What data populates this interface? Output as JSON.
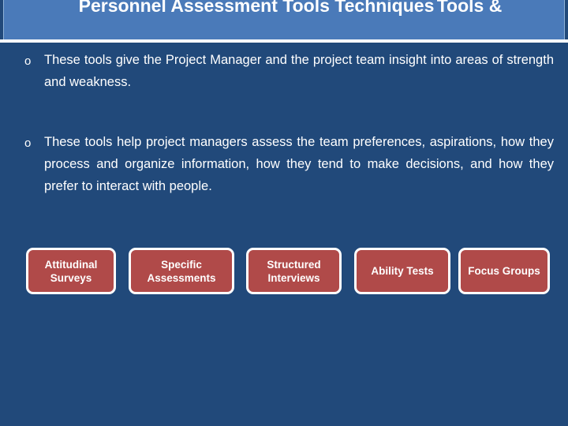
{
  "slide": {
    "background_color": "#21497a",
    "header": {
      "band_color": "#4a7ab9",
      "title_main": "Personnel Assessment Tools Techniques",
      "title_secondary": "Tools &"
    },
    "bullets": [
      {
        "marker": "circle-outline-bullet",
        "marker_glyph": "o",
        "text": "These tools give the Project Manager and the project team insight into areas of strength and weakness."
      },
      {
        "marker": "circle-outline-bullet",
        "marker_glyph": "o",
        "text": "These tools help project managers assess the team preferences, aspirations, how they process and organize information, how they tend to make decisions, and how they prefer to interact with people."
      }
    ],
    "term_boxes": {
      "fill_color": "#b04a49",
      "border_color": "#ffffff",
      "items": [
        {
          "label": "Attitudinal Surveys"
        },
        {
          "label": "Specific Assessments"
        },
        {
          "label": "Structured Interviews"
        },
        {
          "label": "Ability Tests"
        },
        {
          "label": "Focus Groups"
        }
      ]
    }
  }
}
